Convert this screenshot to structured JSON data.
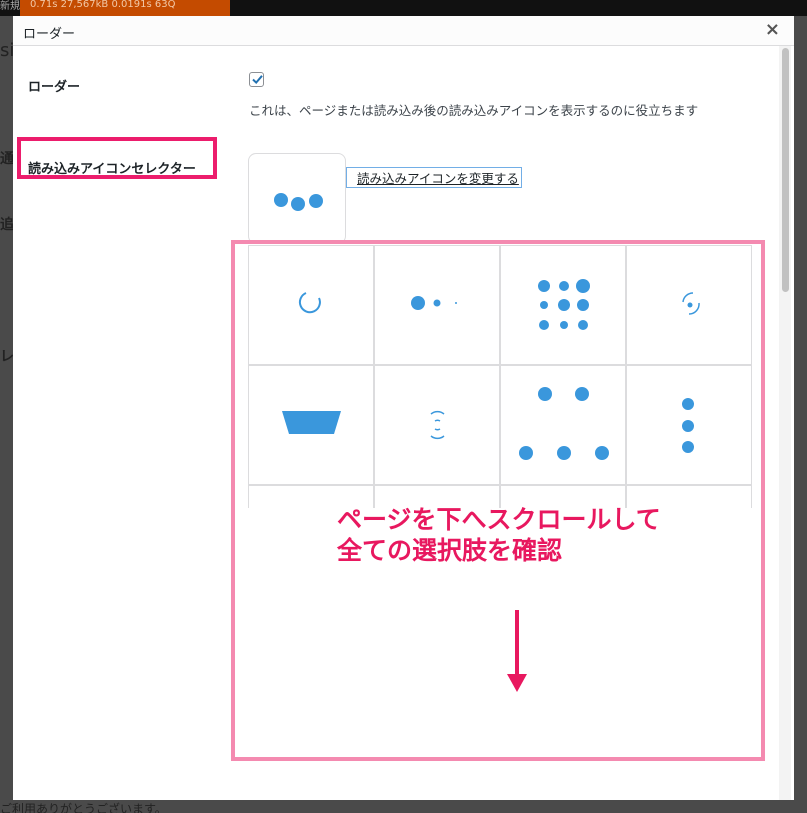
{
  "admin_bar": {
    "left_label": "新規",
    "query_monitor": "0.71s  27,567kB  0.0191s  63Q"
  },
  "background": {
    "frag_si": "si",
    "frag_tsu": "通",
    "frag_oi": "追",
    "frag_re": "レ",
    "footer": "ご利用ありがとうございます。"
  },
  "modal": {
    "title": "ローダー",
    "close_glyph": "×",
    "loader_row": {
      "label": "ローダー",
      "checked": true,
      "description": "これは、ページまたは読み込み後の読み込みアイコンを表示するのに役立ちます"
    },
    "selector_row": {
      "label": "読み込みアイコンセレクター",
      "change_link": "読み込みアイコンを変更する"
    },
    "icon_options": [
      "spinner-ring-icon",
      "dots-fade-icon",
      "dot-grid-icon",
      "orbit-icon",
      "bucket-icon",
      "pulse-rings-icon",
      "triangle-dots-icon",
      "vertical-dots-icon"
    ]
  },
  "annotation": {
    "callout_line1": "ページを下へスクロールして",
    "callout_line2": "全ての選択肢を確認",
    "highlight_color": "#ec1d6c",
    "area_color": "#f48ab0"
  },
  "colors": {
    "icon_blue": "#3a97dc",
    "accent_pink": "#e8185f"
  }
}
